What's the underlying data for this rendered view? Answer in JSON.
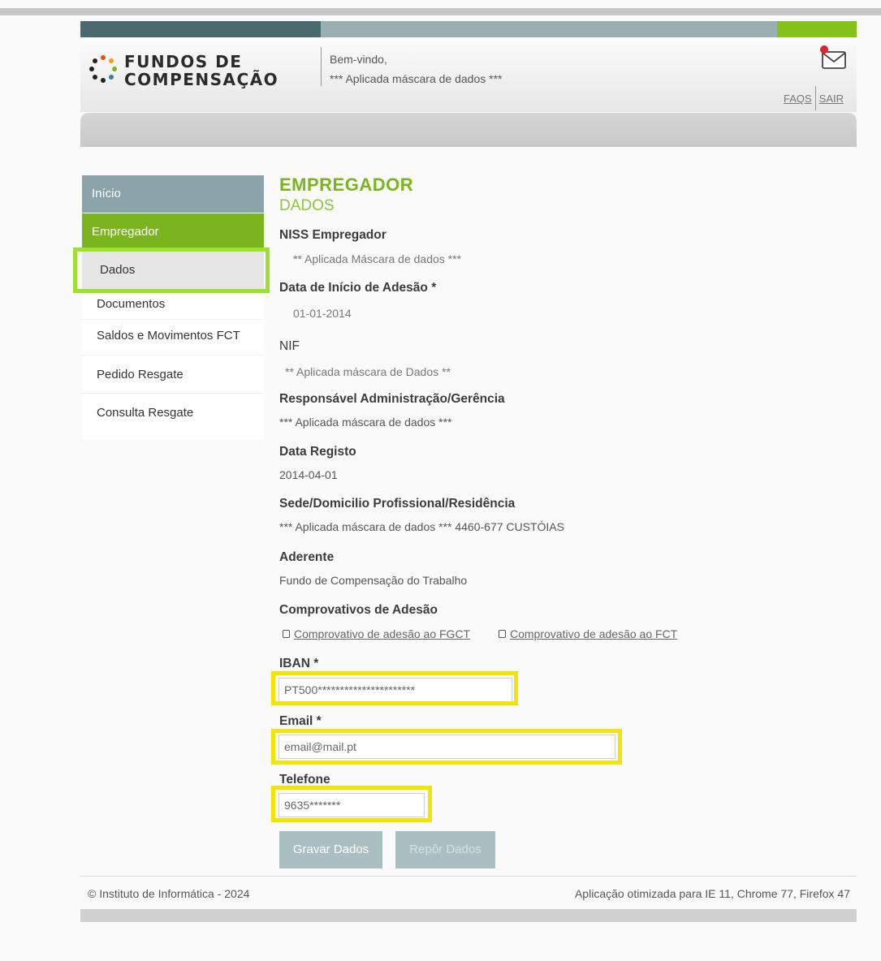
{
  "brand": {
    "line1": "FUNDOS DE",
    "line2": "COMPENSAÇÃO"
  },
  "header": {
    "welcome": "Bem-vindo,",
    "user": "*** Aplicada máscara de dados ***",
    "faqs": "FAQS",
    "sair": "SAIR",
    "mail_icon": "mail-notification-icon"
  },
  "colors": {
    "accent_green": "#7ab51f",
    "nav_blue_grey": "#8aa4a9",
    "highlight_yellow": "#f2e600",
    "highlight_green": "#9ee02e"
  },
  "sidebar": {
    "inicio": "Início",
    "empregador": "Empregador",
    "dados": "Dados",
    "documentos": "Documentos",
    "saldos": "Saldos e Movimentos FCT",
    "pedido": "Pedido Resgate",
    "consulta": "Consulta Resgate"
  },
  "page": {
    "title": "EMPREGADOR",
    "subtitle": "DADOS"
  },
  "fields": {
    "niss_label": "NISS Empregador",
    "niss_value": "** Aplicada Máscara de dados ***",
    "data_inicio_label": "Data de Início de Adesão *",
    "data_inicio_value": "01-01-2014",
    "nif_label": "NIF",
    "nif_value": "** Aplicada máscara de Dados **",
    "responsavel_label": "Responsável Administração/Gerência",
    "responsavel_value": "*** Aplicada máscara de dados ***",
    "data_registo_label": "Data Registo",
    "data_registo_value": "2014-04-01",
    "sede_label": "Sede/Domicilio Profissional/Residência",
    "sede_value": "*** Aplicada máscara de dados *** 4460-677 CUSTÓIAS",
    "aderente_label": "Aderente",
    "aderente_value": "Fundo de Compensação do Trabalho",
    "comprovativos_label": "Comprovativos de Adesão",
    "comp_fgct": "Comprovativo de adesão ao FGCT",
    "comp_fct": "Comprovativo de adesão ao FCT",
    "iban_label": "IBAN *",
    "iban_value": "PT500**********************",
    "email_label": "Email *",
    "email_value": "email@mail.pt",
    "telefone_label": "Telefone",
    "telefone_value": "9635*******"
  },
  "buttons": {
    "gravar": "Gravar Dados",
    "repor": "Repôr Dados"
  },
  "footer": {
    "left": "© Instituto de Informática - 2024",
    "right": "Aplicação otimizada para IE 11, Chrome 77, Firefox 47"
  }
}
